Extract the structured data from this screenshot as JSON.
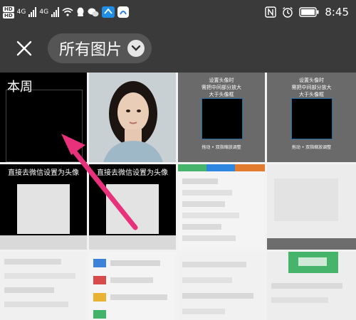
{
  "statusbar": {
    "left_badges": [
      "HD",
      "HD"
    ],
    "net1": "4G",
    "net2": "4G",
    "time": "8:45"
  },
  "topbar": {
    "close_icon": "close-icon",
    "album_title": "所有图片",
    "dropdown_icon": "chevron-down-icon"
  },
  "section": {
    "label": "本周"
  },
  "thumbs": {
    "t3_caption": [
      "设置头像时",
      "需把中间部分放大",
      "大于头像框"
    ],
    "t3_small": "拖动 • 双指缩放调整",
    "t4_caption": [
      "设置头像时",
      "需把中间部分放大",
      "大于头像框"
    ],
    "t4_small": "拖动 • 双指缩放调整",
    "t5_caption": [
      "直接去微信设置为头像"
    ],
    "t6_caption": [
      "直接去微信设置为头像"
    ]
  },
  "colors": {
    "bar": "#3a3a3a",
    "pill": "#555555",
    "arrow": "#e8317a"
  }
}
